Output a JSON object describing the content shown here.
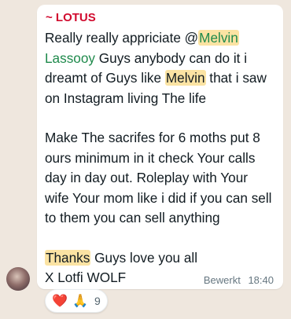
{
  "message": {
    "sender": "~ LOTUS",
    "line1_pre": "Really really appriciate @",
    "mention_first": "Melvin",
    "mention_last": "Lassooy",
    "line1_post": " Guys anybody can do it i dreamt of Guys like ",
    "name_highlight": "Melvin",
    "line1_end": " that i saw on Instagram living The life",
    "paragraph2": "Make The sacrifes for 6 moths put 8 ours minimum in it check Your calls day in day out. Roleplay with Your wife Your mom like i did if you can sell to them you can sell anything",
    "thanks_highlight": "Thanks",
    "thanks_rest": " Guys love you all",
    "signature": "X Lotfi WOLF",
    "edited_label": "Bewerkt",
    "time": "18:40"
  },
  "reactions": {
    "emoji1": "❤️",
    "emoji2": "🙏",
    "count": "9"
  }
}
